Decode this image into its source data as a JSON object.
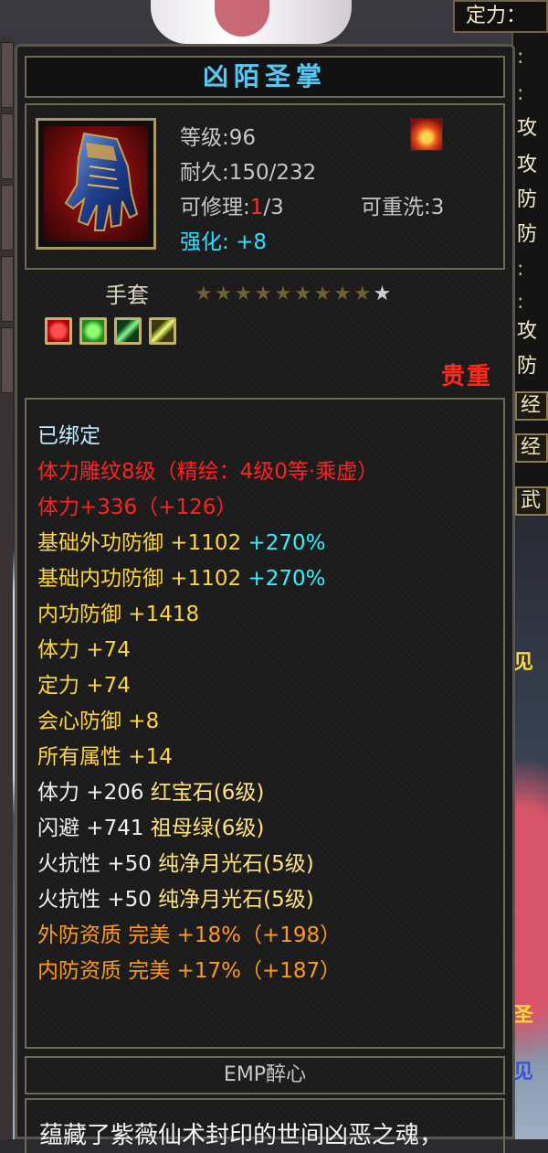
{
  "background": {
    "right_panel": {
      "header": "定力：",
      "items": [
        ":",
        ":",
        "攻",
        "攻",
        "防",
        "防",
        ":",
        ":",
        "攻",
        "防"
      ],
      "buttons": [
        "经",
        "经",
        "武"
      ],
      "side_labels": [
        "见",
        "圣",
        "见"
      ]
    }
  },
  "tooltip": {
    "title": "凶陌圣掌",
    "level": "等级:96",
    "durability": "耐久:150/232",
    "repair_label": "可修理:",
    "repair_used": "1",
    "repair_total": "/3",
    "rewash": "可重洗:3",
    "enhance_label": "强化:",
    "enhance_value": "+8",
    "type": "手套",
    "stars": {
      "filled": 9,
      "total": 10
    },
    "rarity": "贵重",
    "attributes": [
      {
        "segments": [
          {
            "text": "已绑定",
            "color": "bound"
          }
        ]
      },
      {
        "segments": [
          {
            "text": "体力雕纹8级（精绘：4级0等·乘虚）",
            "color": "red"
          }
        ]
      },
      {
        "segments": [
          {
            "text": "体力+336（+126）",
            "color": "red"
          }
        ]
      },
      {
        "segments": [
          {
            "text": "基础外功防御 +1102 ",
            "color": "gold"
          },
          {
            "text": "+270%",
            "color": "cyan"
          }
        ]
      },
      {
        "segments": [
          {
            "text": "基础内功防御 +1102 ",
            "color": "gold"
          },
          {
            "text": "+270%",
            "color": "cyan"
          }
        ]
      },
      {
        "segments": [
          {
            "text": "内功防御 +1418",
            "color": "gold"
          }
        ]
      },
      {
        "segments": [
          {
            "text": "体力 +74",
            "color": "gold"
          }
        ]
      },
      {
        "segments": [
          {
            "text": "定力 +74",
            "color": "gold"
          }
        ]
      },
      {
        "segments": [
          {
            "text": "会心防御 +8",
            "color": "gold"
          }
        ]
      },
      {
        "segments": [
          {
            "text": "所有属性 +14",
            "color": "gold"
          }
        ]
      },
      {
        "segments": [
          {
            "text": "体力 +206 ",
            "color": "white"
          },
          {
            "text": "红宝石(6级)",
            "color": "ltgold"
          }
        ]
      },
      {
        "segments": [
          {
            "text": "闪避 +741 ",
            "color": "white"
          },
          {
            "text": "祖母绿(6级)",
            "color": "ltgold"
          }
        ]
      },
      {
        "segments": [
          {
            "text": "火抗性 +50 ",
            "color": "white"
          },
          {
            "text": "纯净月光石(5级)",
            "color": "ltgold"
          }
        ]
      },
      {
        "segments": [
          {
            "text": "火抗性 +50 ",
            "color": "white"
          },
          {
            "text": "纯净月光石(5级)",
            "color": "ltgold"
          }
        ]
      },
      {
        "segments": [
          {
            "text": "外防资质  完美 +18%（+198）",
            "color": "orange"
          }
        ]
      },
      {
        "segments": [
          {
            "text": "内防资质  完美 +17%（+187）",
            "color": "orange"
          }
        ]
      }
    ],
    "footer": "EMP醉心",
    "description": "蕴藏了紫薇仙术封印的世间凶恶之魂，"
  },
  "colors": {
    "title": "#5cc7ef",
    "bound": "#bfe8ff",
    "red": "#ff2222",
    "gold": "#ffd53a",
    "cyan": "#2ff4ff",
    "orange": "#ff9a1a",
    "ltgold": "#ffe27a",
    "white": "#f0f0f0"
  },
  "icons": [
    "gauntlet-icon",
    "fire-element-icon",
    "ruby-gem-icon",
    "emerald-gem-icon",
    "moonstone-gem-icon",
    "moonstone-gem-icon-2"
  ]
}
